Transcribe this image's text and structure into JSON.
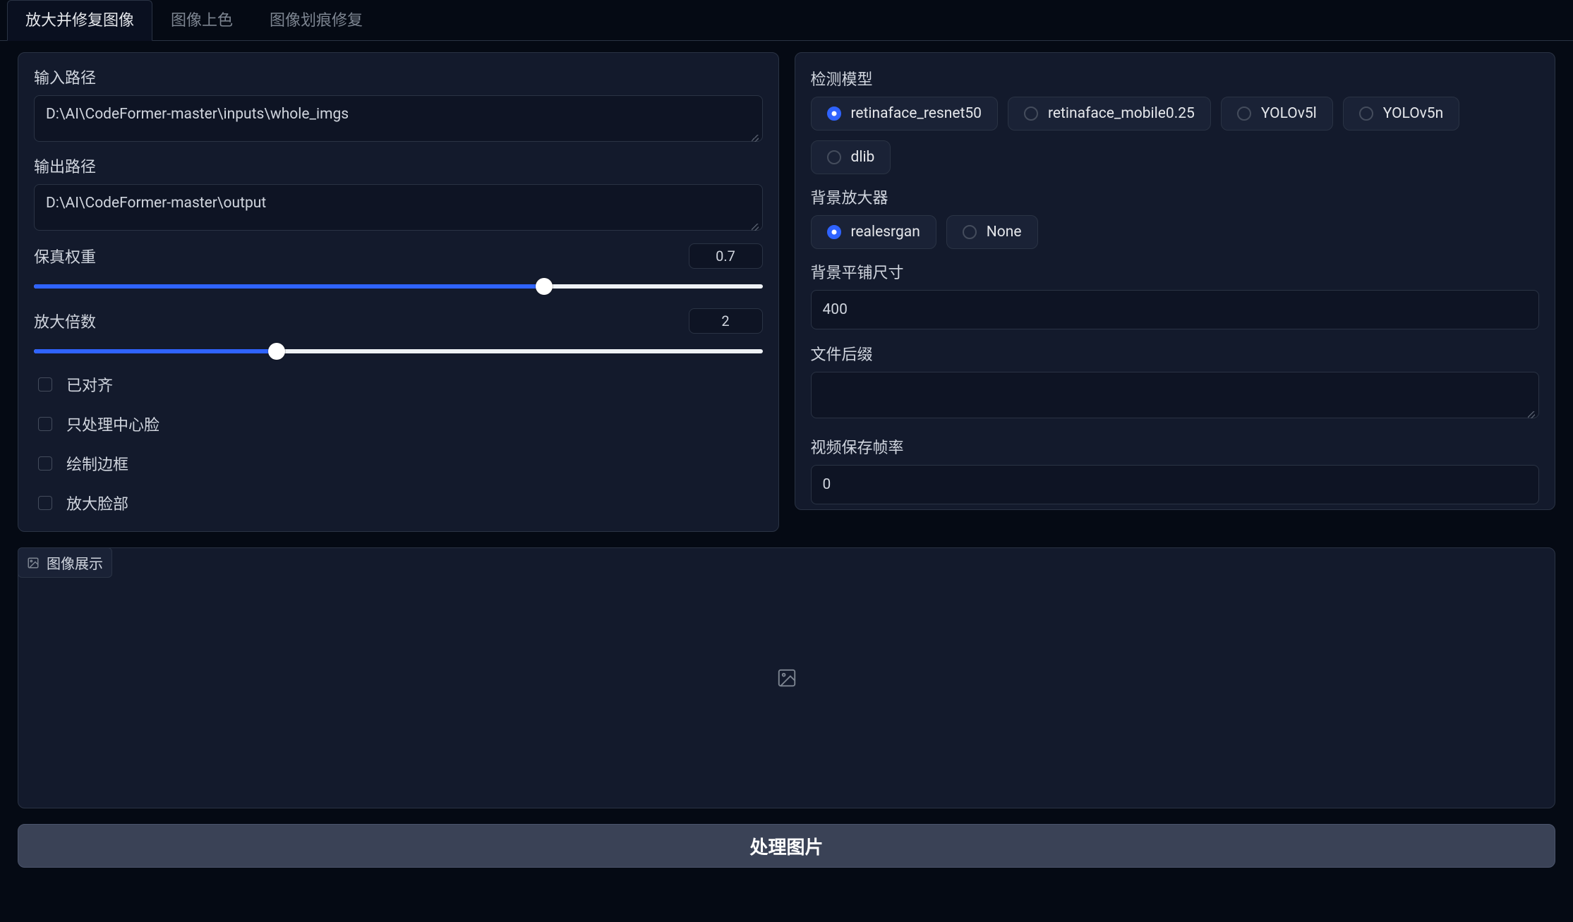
{
  "tabs": [
    {
      "label": "放大并修复图像",
      "active": true
    },
    {
      "label": "图像上色",
      "active": false
    },
    {
      "label": "图像划痕修复",
      "active": false
    }
  ],
  "left": {
    "input_path": {
      "label": "输入路径",
      "value": "D:\\AI\\CodeFormer-master\\inputs\\whole_imgs"
    },
    "output_path": {
      "label": "输出路径",
      "value": "D:\\AI\\CodeFormer-master\\output"
    },
    "fidelity": {
      "label": "保真权重",
      "value": "0.7",
      "pct": 70
    },
    "upscale": {
      "label": "放大倍数",
      "value": "2",
      "pct": 33.3
    },
    "checks": [
      {
        "label": "已对齐"
      },
      {
        "label": "只处理中心脸"
      },
      {
        "label": "绘制边框"
      },
      {
        "label": "放大脸部"
      }
    ]
  },
  "right": {
    "detect_label": "检测模型",
    "detect_options": [
      "retinaface_resnet50",
      "retinaface_mobile0.25",
      "YOLOv5l",
      "YOLOv5n",
      "dlib"
    ],
    "detect_selected": "retinaface_resnet50",
    "bg_label": "背景放大器",
    "bg_options": [
      "realesrgan",
      "None"
    ],
    "bg_selected": "realesrgan",
    "tile": {
      "label": "背景平铺尺寸",
      "value": "400"
    },
    "suffix": {
      "label": "文件后缀",
      "value": ""
    },
    "fps": {
      "label": "视频保存帧率",
      "value": "0"
    }
  },
  "gallery_label": "图像展示",
  "run_label": "处理图片"
}
